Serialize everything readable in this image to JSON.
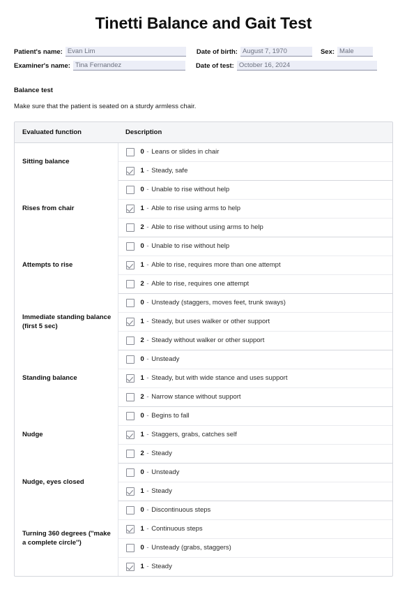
{
  "document": {
    "title": "Tinetti Balance and Gait Test"
  },
  "patient_info": {
    "fields": [
      {
        "label": "Patient's name:",
        "value": "Evan Lim"
      },
      {
        "label": "Date of birth:",
        "value": "August 7, 1970"
      },
      {
        "label": "Sex:",
        "value": "Male"
      },
      {
        "label": "Examiner's name:",
        "value": "Tina Fernandez"
      },
      {
        "label": "Date of test:",
        "value": "October 16, 2024"
      }
    ]
  },
  "balance_section": {
    "heading": "Balance test",
    "instruction": "Make sure that the patient is seated on a sturdy armless chair."
  },
  "table": {
    "headers": {
      "function": "Evaluated function",
      "description": "Description"
    },
    "groups": [
      {
        "function": "Sitting balance",
        "options": [
          {
            "score": "0",
            "text": "Leans or slides in chair",
            "checked": false
          },
          {
            "score": "1",
            "text": "Steady, safe",
            "checked": true
          }
        ]
      },
      {
        "function": "Rises from chair",
        "options": [
          {
            "score": "0",
            "text": "Unable to rise without help",
            "checked": false
          },
          {
            "score": "1",
            "text": "Able to rise using arms to help",
            "checked": true
          },
          {
            "score": "2",
            "text": "Able to rise without using arms to help",
            "checked": false
          }
        ]
      },
      {
        "function": "Attempts to rise",
        "options": [
          {
            "score": "0",
            "text": "Unable to rise without help",
            "checked": false
          },
          {
            "score": "1",
            "text": "Able to rise, requires more than one attempt",
            "checked": true
          },
          {
            "score": "2",
            "text": "Able to rise, requires one attempt",
            "checked": false
          }
        ]
      },
      {
        "function": "Immediate standing balance (first 5 sec)",
        "options": [
          {
            "score": "0",
            "text": "Unsteady (staggers, moves feet, trunk sways)",
            "checked": false
          },
          {
            "score": "1",
            "text": "Steady, but uses walker or other support",
            "checked": true
          },
          {
            "score": "2",
            "text": "Steady without walker or other support",
            "checked": false
          }
        ]
      },
      {
        "function": "Standing balance",
        "options": [
          {
            "score": "0",
            "text": "Unsteady",
            "checked": false
          },
          {
            "score": "1",
            "text": "Steady, but with wide stance and uses support",
            "checked": true
          },
          {
            "score": "2",
            "text": "Narrow stance without support",
            "checked": false
          }
        ]
      },
      {
        "function": "Nudge",
        "options": [
          {
            "score": "0",
            "text": "Begins to fall",
            "checked": false
          },
          {
            "score": "1",
            "text": "Staggers, grabs, catches self",
            "checked": true
          },
          {
            "score": "2",
            "text": "Steady",
            "checked": false
          }
        ]
      },
      {
        "function": "Nudge, eyes closed",
        "options": [
          {
            "score": "0",
            "text": "Unsteady",
            "checked": false
          },
          {
            "score": "1",
            "text": "Steady",
            "checked": true
          }
        ]
      },
      {
        "function": "Turning 360 degrees (''make a complete circle'')",
        "options": [
          {
            "score": "0",
            "text": "Discontinuous steps",
            "checked": false
          },
          {
            "score": "1",
            "text": "Continuous steps",
            "checked": true
          },
          {
            "score": "0",
            "text": "Unsteady (grabs, staggers)",
            "checked": false
          },
          {
            "score": "1",
            "text": "Steady",
            "checked": true
          }
        ]
      }
    ]
  }
}
